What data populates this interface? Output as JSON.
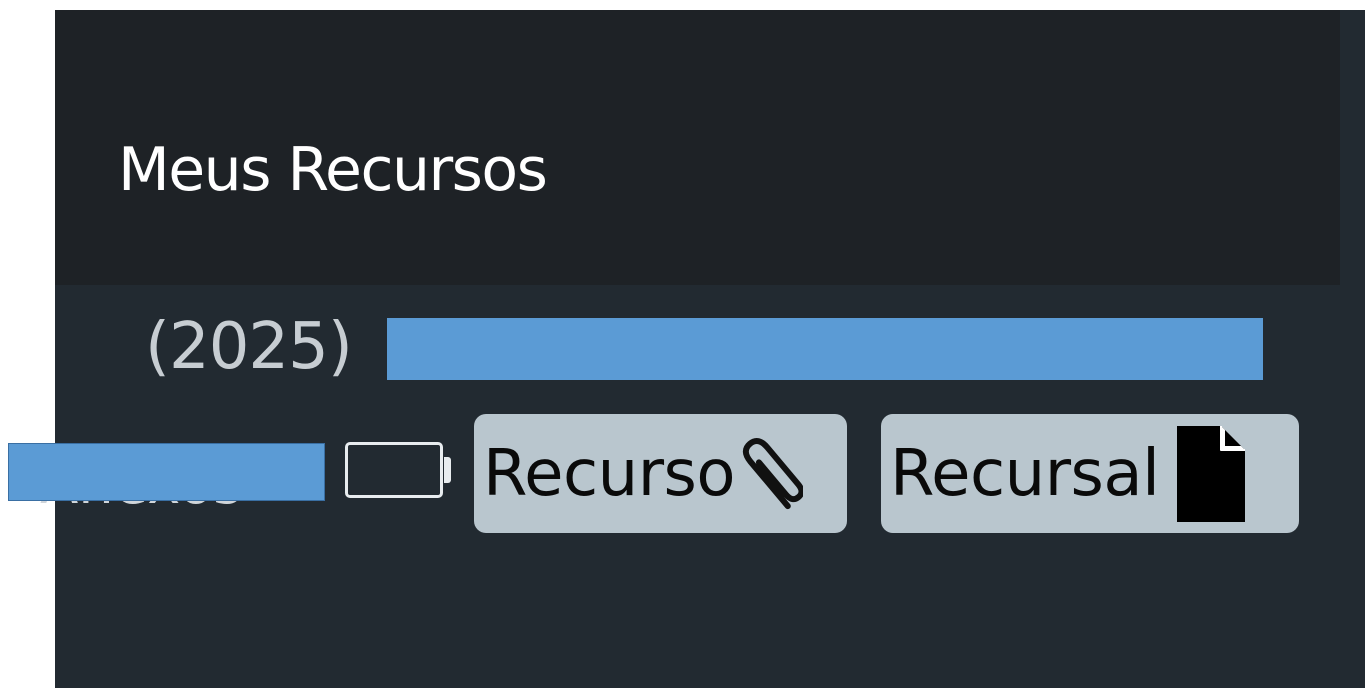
{
  "panel": {
    "title": "Meus Recursos",
    "year": "(2025)"
  },
  "resource_row": {
    "ghost_text": "Anexos",
    "tags": [
      {
        "label": "Recurso",
        "icon": "paperclip-icon"
      },
      {
        "label": "Recursal",
        "icon": "document-icon"
      }
    ]
  },
  "colors": {
    "panel_bg": "#222a31",
    "header_bg": "#1e2226",
    "redaction": "#5b9bd5",
    "tag_bg": "#b9c6ce"
  }
}
